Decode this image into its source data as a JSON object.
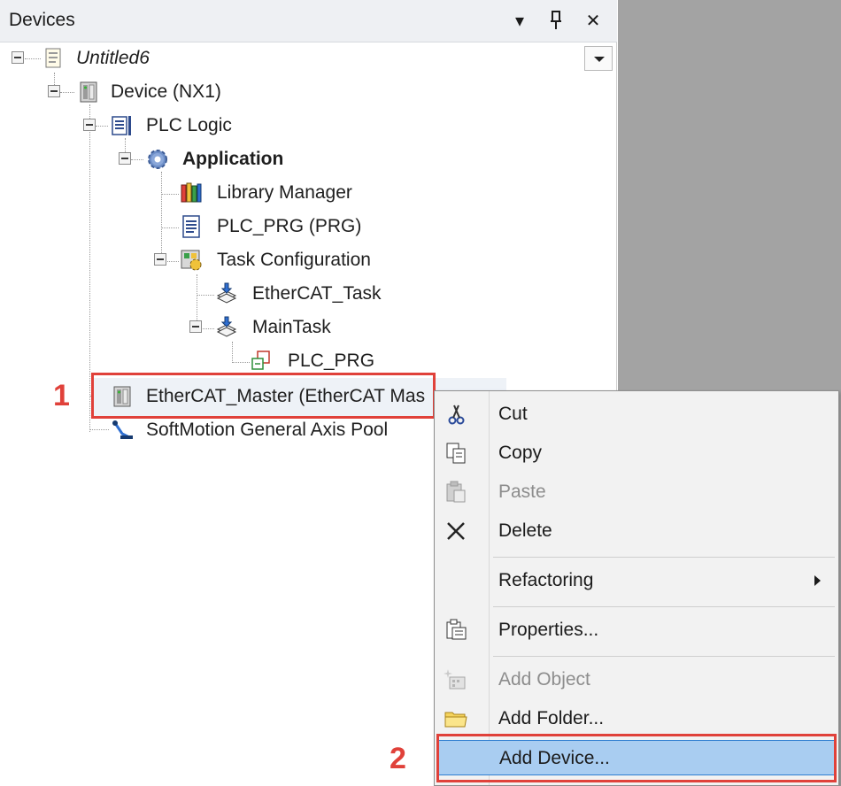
{
  "panel": {
    "title": "Devices",
    "header_icons": [
      "dropdown-arrow-icon",
      "pin-icon",
      "close-icon"
    ]
  },
  "tree": {
    "root": "Untitled6",
    "device": "Device (NX1)",
    "plc_logic": "PLC Logic",
    "application": "Application",
    "library_manager": "Library Manager",
    "plc_prg": "PLC_PRG (PRG)",
    "task_configuration": "Task Configuration",
    "ethercat_task": "EtherCAT_Task",
    "main_task": "MainTask",
    "main_task_plc_prg": "PLC_PRG",
    "ethercat_master": "EtherCAT_Master (EtherCAT Mas",
    "softmotion_pool": "SoftMotion General Axis Pool"
  },
  "context_menu": {
    "items": [
      {
        "label": "Cut",
        "icon": "scissors-icon",
        "enabled": true
      },
      {
        "label": "Copy",
        "icon": "copy-icon",
        "enabled": true
      },
      {
        "label": "Paste",
        "icon": "paste-icon",
        "enabled": false
      },
      {
        "label": "Delete",
        "icon": "delete-x-icon",
        "enabled": true
      },
      {
        "label": "Refactoring",
        "icon": "",
        "enabled": true,
        "submenu": true
      },
      {
        "label": "Properties...",
        "icon": "properties-icon",
        "enabled": true
      },
      {
        "label": "Add Object",
        "icon": "add-object-icon",
        "enabled": false
      },
      {
        "label": "Add Folder...",
        "icon": "folder-icon",
        "enabled": true
      },
      {
        "label": "Add Device...",
        "icon": "",
        "enabled": true,
        "highlighted": true
      }
    ]
  },
  "annotations": {
    "step1": "1",
    "step2": "2",
    "color": "#e0413a"
  },
  "colors": {
    "highlight": "#a9cdf1",
    "highlight_border": "#2f7fd1",
    "gray_background": "#a3a3a3"
  }
}
